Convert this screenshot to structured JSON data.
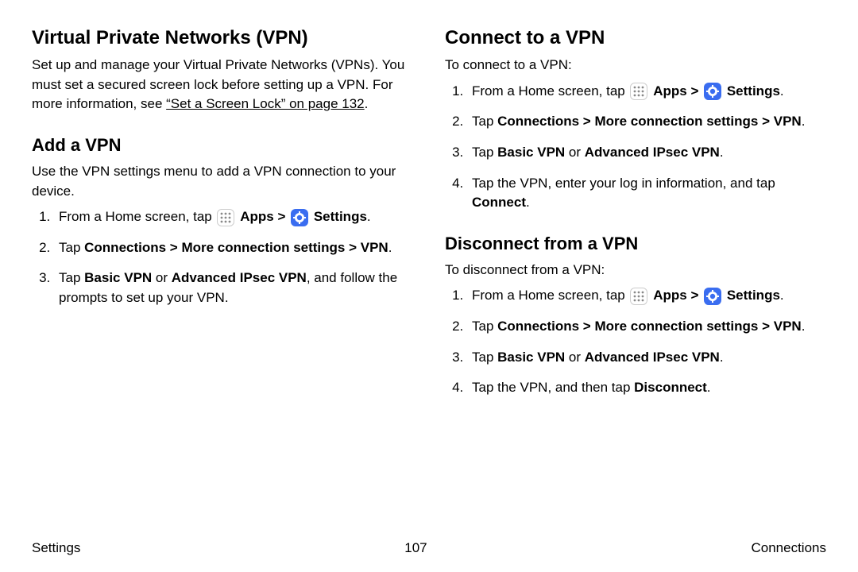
{
  "left": {
    "h2": "Virtual Private Networks (VPN)",
    "intro_pre": "Set up and manage your Virtual Private Networks (VPNs). You must set a secured screen lock before setting up a VPN. For more information, see ",
    "intro_link": "“Set a Screen Lock” on page 132",
    "intro_post": ".",
    "h3": "Add a VPN",
    "p": "Use the VPN settings menu to add a VPN connection to your device.",
    "steps": {
      "s1_pre": "From a Home screen, tap ",
      "s1_apps": "Apps",
      "s1_settings": "Settings",
      "s2_pre": "Tap ",
      "s2_bold": "Connections > More connection settings > VPN",
      "s3_pre": "Tap ",
      "s3_bold1": "Basic VPN",
      "s3_mid": " or ",
      "s3_bold2": "Advanced IPsec VPN",
      "s3_post": ", and follow the prompts to set up your VPN."
    }
  },
  "right": {
    "h2": "Connect to a VPN",
    "p": "To connect to a VPN:",
    "steps": {
      "s1_pre": "From a Home screen, tap ",
      "s1_apps": "Apps",
      "s1_settings": "Settings",
      "s2_pre": "Tap ",
      "s2_bold": "Connections > More connection settings > VPN",
      "s3_pre": "Tap ",
      "s3_bold1": "Basic VPN",
      "s3_mid": " or ",
      "s3_bold2": "Advanced IPsec VPN",
      "s4_pre": "Tap the VPN, enter your log in information, and tap ",
      "s4_bold": "Connect"
    },
    "h3": "Disconnect from a VPN",
    "p2": "To disconnect from a VPN:",
    "dsteps": {
      "s1_pre": "From a Home screen, tap ",
      "s1_apps": "Apps",
      "s1_settings": "Settings",
      "s2_pre": "Tap ",
      "s2_bold": "Connections > More connection settings > VPN",
      "s3_pre": "Tap ",
      "s3_bold1": "Basic VPN",
      "s3_mid": " or ",
      "s3_bold2": "Advanced IPsec VPN",
      "s4_pre": "Tap the VPN, and then tap ",
      "s4_bold": "Disconnect"
    }
  },
  "footer": {
    "left": "Settings",
    "center": "107",
    "right": "Connections"
  }
}
